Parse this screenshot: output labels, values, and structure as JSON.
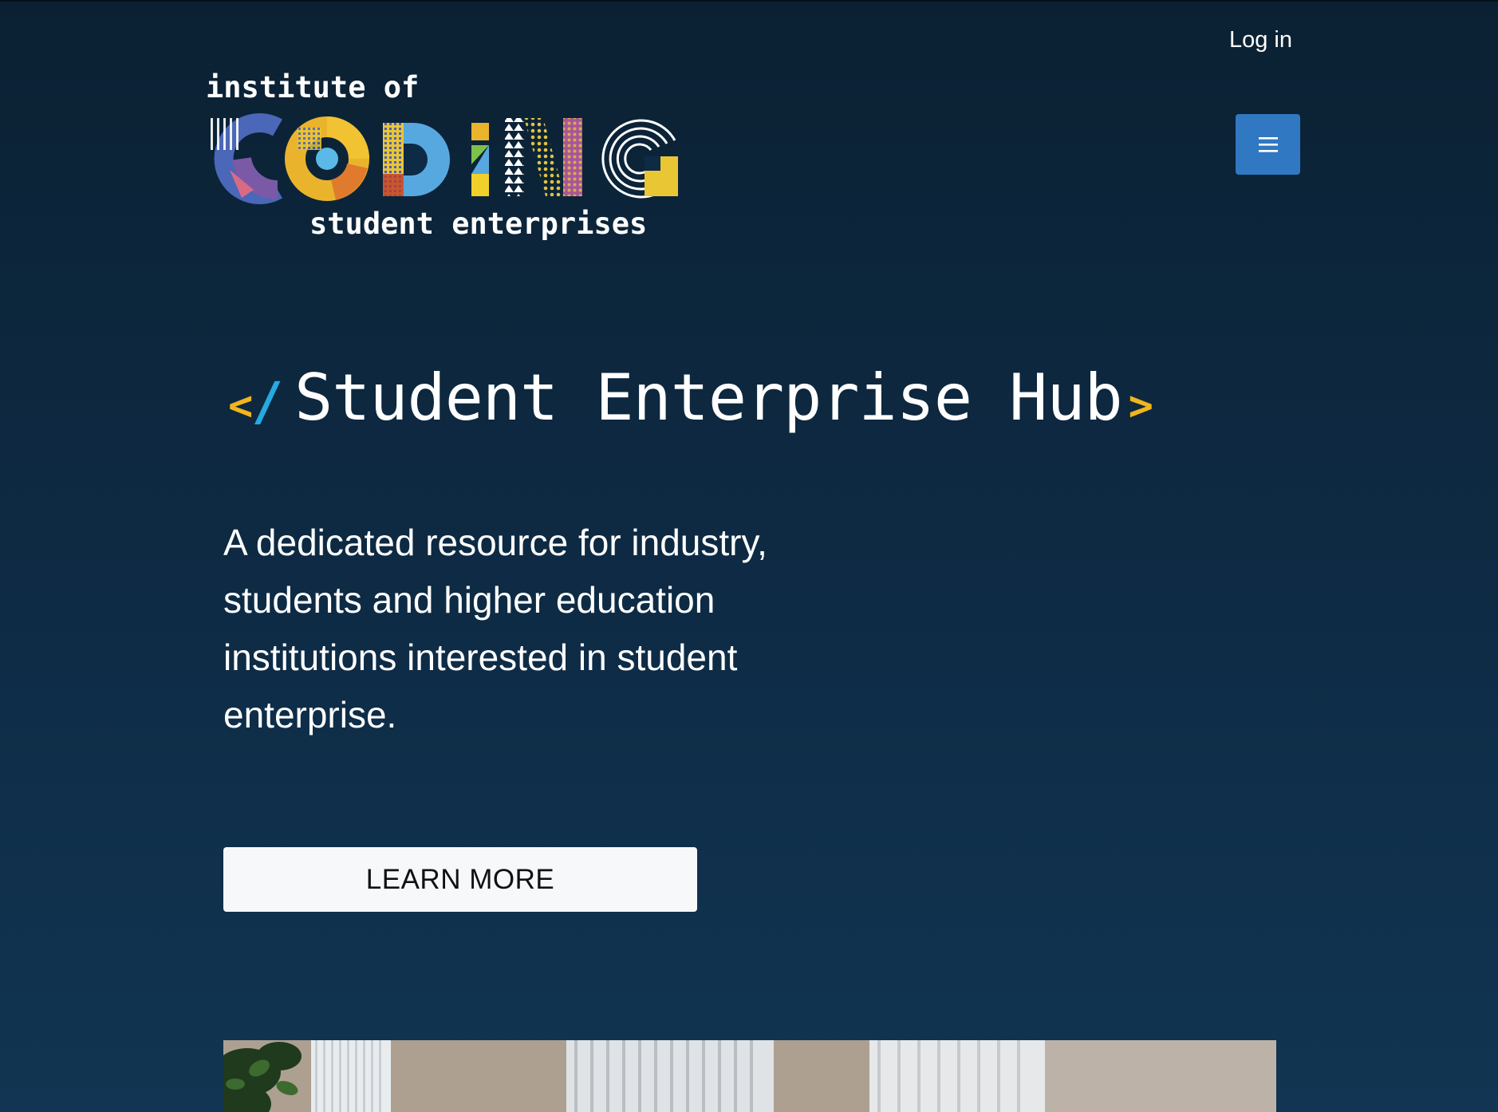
{
  "header": {
    "login_label": "Log in",
    "menu_icon": "hamburger-menu-icon",
    "menu_color": "#3178c2"
  },
  "logo": {
    "line1": "institute of",
    "wordmark": "CODING",
    "line2": "student enterprises"
  },
  "hero": {
    "open_bracket": "<",
    "slash": "/",
    "title": "Student Enterprise Hub",
    "close_bracket": ">",
    "tagline": "A dedicated resource for industry, students and higher education institutions interested in student enterprise.",
    "cta_label": "LEARN MORE"
  },
  "colors": {
    "background_top": "#0b2133",
    "background_bottom": "#113552",
    "bracket": "#f2b51c",
    "slash": "#27a9e1",
    "button_bg": "#f7f8fa"
  }
}
